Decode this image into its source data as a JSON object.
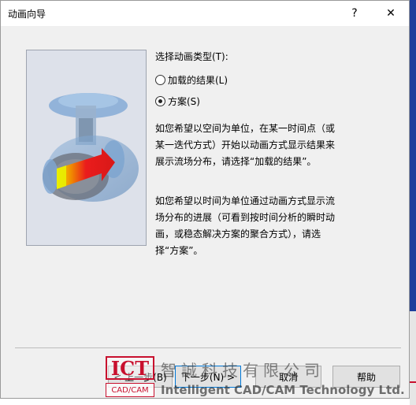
{
  "window": {
    "title": "动画向导",
    "help_glyph": "?",
    "close_glyph": "✕"
  },
  "options": {
    "group_label": "选择动画类型(T):",
    "loaded_results_label": "加载的结果(L)",
    "solutions_label": "方案(S)",
    "selected": "solutions"
  },
  "descriptions": {
    "para1": "如您希望以空间为单位，在某一时间点（或某一迭代方式）开始以动画方式显示结果来展示流场分布，请选择“加载的结果”。",
    "para2": "如您希望以时间为单位通过动画方式显示流场分布的进展（可看到按时间分析的瞬时动画，或稳态解决方案的聚合方式），请选择“方案”。"
  },
  "buttons": {
    "back": "< 上一步(B)",
    "next": "下一步(N) >",
    "cancel": "取消",
    "help": "帮助"
  },
  "watermark": {
    "logo_top": "ICT",
    "logo_bottom": "CAD/CAM",
    "name_cn": "智誠科技有限公司",
    "name_en": "Intelligent CAD/CAM Technology Ltd."
  },
  "colors": {
    "accent": "#0078d7",
    "watermark_red": "#c8102e"
  }
}
